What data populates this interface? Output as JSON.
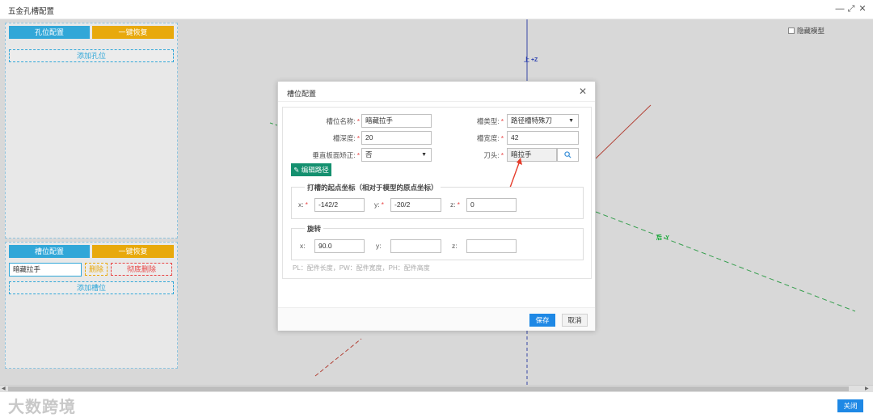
{
  "window": {
    "title": "五金孔槽配置",
    "minimize_glyph": "—",
    "maximize_glyph": "⤢",
    "close_glyph": "✕"
  },
  "hole_panel": {
    "config_label": "孔位配置",
    "restore_label": "一键恢复",
    "add_label": "添加孔位"
  },
  "slot_panel": {
    "config_label": "槽位配置",
    "restore_label": "一键恢复",
    "slot_item_name": "暗藏拉手",
    "delete_label": "删除",
    "delete_all_label": "彻底删除",
    "add_label": "添加槽位"
  },
  "hide_model_label": "隐藏模型",
  "axes": {
    "z_label": "上 +Z",
    "y_label": "后 -Y"
  },
  "dialog": {
    "title": "槽位配置",
    "close_glyph": "✕",
    "slot_name_label": "槽位名称:",
    "slot_name_value": "暗藏拉手",
    "slot_type_label": "槽类型:",
    "slot_type_value": "路径槽特殊刀",
    "slot_depth_label": "槽深度:",
    "slot_depth_value": "20",
    "slot_width_label": "槽宽度:",
    "slot_width_value": "42",
    "vertical_fix_label": "垂直板面矫正:",
    "vertical_fix_value": "否",
    "tool_label": "刀头:",
    "tool_value": "暗拉手",
    "edit_path_label": "编辑路径",
    "start_coord_legend": "打槽的起点坐标（相对于模型的原点坐标）",
    "x_label": "x:",
    "x_value": "-142/2",
    "y_label": "y:",
    "y_value": "-20/2",
    "z_label": "z:",
    "z_value": "0",
    "rotation_legend": "旋转",
    "rx_label": "x:",
    "rx_value": "90.0",
    "ry_label": "y:",
    "ry_value": "",
    "rz_label": "z:",
    "rz_value": "",
    "hint": "PL：配件长度，PW：配件宽度，PH：配件高度",
    "save_label": "保存",
    "cancel_label": "取消"
  },
  "footer": {
    "watermark": "大数跨境",
    "close_label": "关闭"
  },
  "colors": {
    "accent_blue": "#31a7d8",
    "accent_gold": "#e8a90c",
    "edit_green": "#14906f",
    "save_blue": "#1e88e5",
    "required_red": "#e84545"
  }
}
